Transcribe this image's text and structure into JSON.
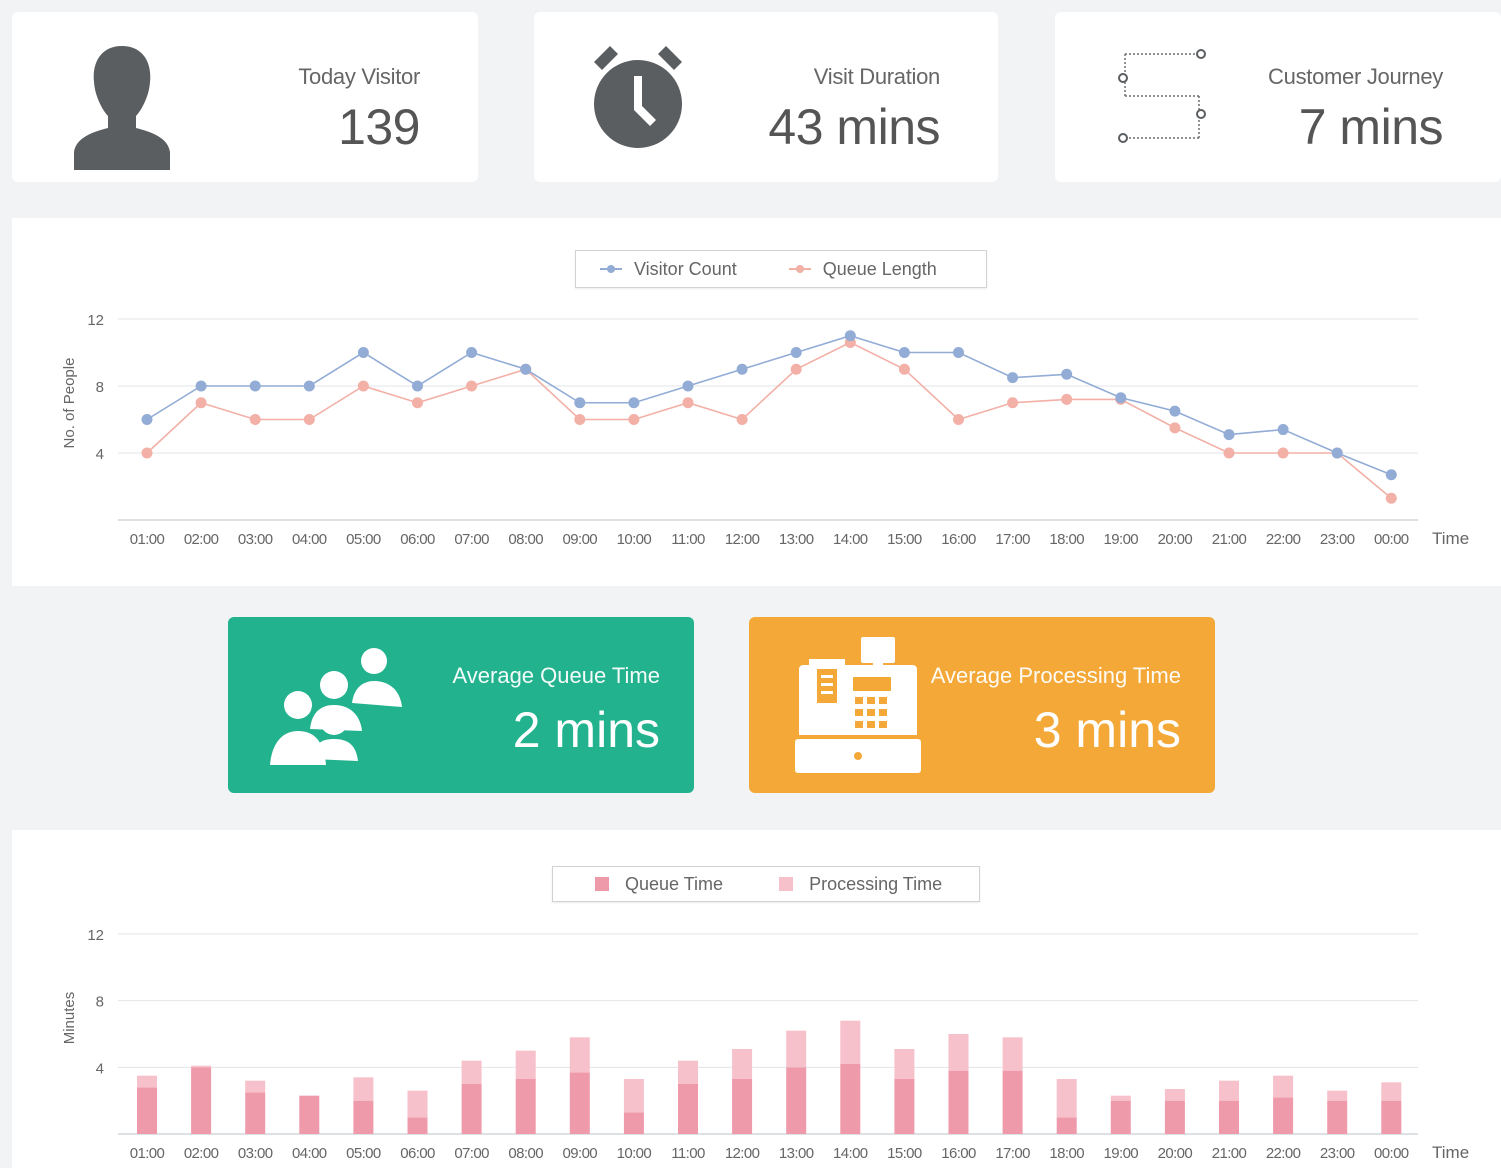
{
  "stats": [
    {
      "label": "Today Visitor",
      "value": "139",
      "icon": "person-icon"
    },
    {
      "label": "Visit Duration",
      "value": "43 mins",
      "icon": "alarm-clock-icon"
    },
    {
      "label": "Customer Journey",
      "value": "7 mins",
      "icon": "journey-path-icon"
    }
  ],
  "kpis": [
    {
      "label": "Average Queue Time",
      "value": "2 mins",
      "color": "#22b28e",
      "icon": "people-group-icon"
    },
    {
      "label": "Average Processing Time",
      "value": "3 mins",
      "color": "#f4a838",
      "icon": "cash-register-icon"
    }
  ],
  "colors": {
    "visitor_count": "#92acd6",
    "queue_length": "#f2b0a6",
    "queue_time": "#ef9aab",
    "processing_time": "#f6c1ca"
  },
  "chart_data": [
    {
      "type": "line",
      "legend": [
        "Visitor Count",
        "Queue Length"
      ],
      "legend_position": "top-center",
      "ylabel": "No. of People",
      "xlabel": "Time",
      "ylim": [
        0,
        12
      ],
      "yticks": [
        "4",
        "8",
        "12"
      ],
      "grid": true,
      "categories": [
        "01:00",
        "02:00",
        "03:00",
        "04:00",
        "05:00",
        "06:00",
        "07:00",
        "08:00",
        "09:00",
        "10:00",
        "11:00",
        "12:00",
        "13:00",
        "14:00",
        "15:00",
        "16:00",
        "17:00",
        "18:00",
        "19:00",
        "20:00",
        "21:00",
        "22:00",
        "23:00",
        "00:00"
      ],
      "series": [
        {
          "name": "Visitor Count",
          "values": [
            6,
            8,
            8,
            8,
            10,
            8,
            10,
            9,
            7,
            7,
            8,
            9,
            10,
            11,
            10,
            10,
            8.5,
            8.7,
            7.3,
            6.5,
            5.1,
            5.4,
            4,
            2.7
          ]
        },
        {
          "name": "Queue Length",
          "values": [
            4,
            7,
            6,
            6,
            8,
            7,
            8,
            9,
            6,
            6,
            7,
            6,
            9,
            10.6,
            9,
            6,
            7,
            7.2,
            7.2,
            5.5,
            4,
            4,
            4,
            1.3
          ]
        }
      ]
    },
    {
      "type": "bar",
      "stacked": true,
      "legend": [
        "Queue Time",
        "Processing Time"
      ],
      "legend_position": "top-center",
      "ylabel": "Minutes",
      "xlabel": "Time",
      "ylim": [
        0,
        12
      ],
      "yticks": [
        "4",
        "8",
        "12"
      ],
      "grid": true,
      "categories": [
        "01:00",
        "02:00",
        "03:00",
        "04:00",
        "05:00",
        "06:00",
        "07:00",
        "08:00",
        "09:00",
        "10:00",
        "11:00",
        "12:00",
        "13:00",
        "14:00",
        "15:00",
        "16:00",
        "17:00",
        "18:00",
        "19:00",
        "20:00",
        "21:00",
        "22:00",
        "23:00",
        "00:00"
      ],
      "series": [
        {
          "name": "Queue Time",
          "values": [
            2.8,
            4,
            2.5,
            2.3,
            2,
            1,
            3,
            3.3,
            3.7,
            1.3,
            3,
            3.3,
            4,
            4.2,
            3.3,
            3.8,
            3.8,
            1,
            2,
            2,
            2,
            2.2,
            2,
            2
          ]
        },
        {
          "name": "Processing Time",
          "values": [
            0.7,
            0.1,
            0.7,
            0,
            1.4,
            1.6,
            1.4,
            1.7,
            2.1,
            2,
            1.4,
            1.8,
            2.2,
            2.6,
            1.8,
            2.2,
            2,
            2.3,
            0.3,
            0.7,
            1.2,
            1.3,
            0.6,
            1.1
          ]
        }
      ]
    }
  ]
}
